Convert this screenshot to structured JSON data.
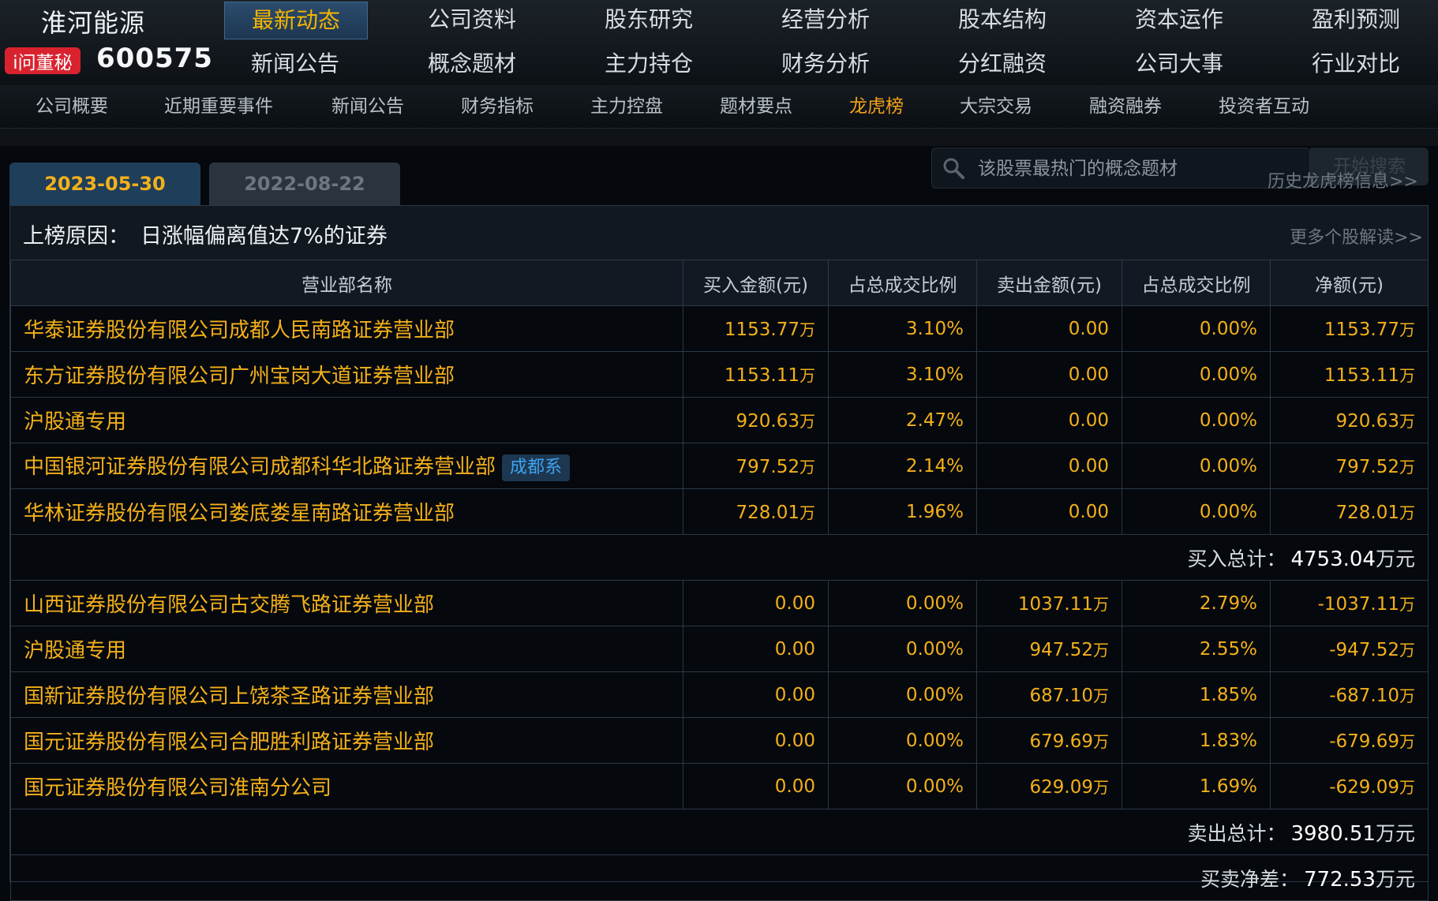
{
  "header": {
    "stock_name": "淮河能源",
    "badge": "i问董秘",
    "stock_code": "600575"
  },
  "top_nav": [
    [
      "最新动态",
      "新闻公告"
    ],
    [
      "公司资料",
      "概念题材"
    ],
    [
      "股东研究",
      "主力持仓"
    ],
    [
      "经营分析",
      "财务分析"
    ],
    [
      "股本结构",
      "分红融资"
    ],
    [
      "资本运作",
      "公司大事"
    ],
    [
      "盈利预测",
      "行业对比"
    ]
  ],
  "top_nav_active": "最新动态",
  "sub_nav": [
    "公司概要",
    "近期重要事件",
    "新闻公告",
    "财务指标",
    "主力控盘",
    "题材要点",
    "龙虎榜",
    "大宗交易",
    "融资融券",
    "投资者互动"
  ],
  "sub_nav_active": "龙虎榜",
  "tabs": [
    "2023-05-30",
    "2022-08-22"
  ],
  "search": {
    "placeholder": "该股票最热门的概念题材",
    "button": "开始搜索"
  },
  "history_link": "历史龙虎榜信息>>",
  "reason": {
    "label": "上榜原因：",
    "text": "日涨幅偏离值达7%的证券"
  },
  "more_link": "更多个股解读>>",
  "table": {
    "headers": [
      "营业部名称",
      "买入金额(元)",
      "占总成交比例",
      "卖出金额(元)",
      "占总成交比例",
      "净额(元)"
    ],
    "buy_rows": [
      {
        "name": "华泰证券股份有限公司成都人民南路证券营业部",
        "buy": "1153.77",
        "buy_pct": "3.10%",
        "sell": "0.00",
        "sell_pct": "0.00%",
        "net": "1153.77",
        "tag": ""
      },
      {
        "name": "东方证券股份有限公司广州宝岗大道证券营业部",
        "buy": "1153.11",
        "buy_pct": "3.10%",
        "sell": "0.00",
        "sell_pct": "0.00%",
        "net": "1153.11",
        "tag": ""
      },
      {
        "name": "沪股通专用",
        "buy": "920.63",
        "buy_pct": "2.47%",
        "sell": "0.00",
        "sell_pct": "0.00%",
        "net": "920.63",
        "tag": ""
      },
      {
        "name": "中国银河证券股份有限公司成都科华北路证券营业部",
        "buy": "797.52",
        "buy_pct": "2.14%",
        "sell": "0.00",
        "sell_pct": "0.00%",
        "net": "797.52",
        "tag": "成都系"
      },
      {
        "name": "华林证券股份有限公司娄底娄星南路证券营业部",
        "buy": "728.01",
        "buy_pct": "1.96%",
        "sell": "0.00",
        "sell_pct": "0.00%",
        "net": "728.01",
        "tag": ""
      }
    ],
    "buy_total_label": "买入总计：",
    "buy_total_value": "4753.04",
    "sell_rows": [
      {
        "name": "山西证券股份有限公司古交腾飞路证券营业部",
        "buy": "0.00",
        "buy_pct": "0.00%",
        "sell": "1037.11",
        "sell_pct": "2.79%",
        "net": "-1037.11"
      },
      {
        "name": "沪股通专用",
        "buy": "0.00",
        "buy_pct": "0.00%",
        "sell": "947.52",
        "sell_pct": "2.55%",
        "net": "-947.52"
      },
      {
        "name": "国新证券股份有限公司上饶茶圣路证券营业部",
        "buy": "0.00",
        "buy_pct": "0.00%",
        "sell": "687.10",
        "sell_pct": "1.85%",
        "net": "-687.10"
      },
      {
        "name": "国元证券股份有限公司合肥胜利路证券营业部",
        "buy": "0.00",
        "buy_pct": "0.00%",
        "sell": "679.69",
        "sell_pct": "1.83%",
        "net": "-679.69"
      },
      {
        "name": "国元证券股份有限公司淮南分公司",
        "buy": "0.00",
        "buy_pct": "0.00%",
        "sell": "629.09",
        "sell_pct": "1.69%",
        "net": "-629.09"
      }
    ],
    "sell_total_label": "卖出总计：",
    "sell_total_value": "3980.51",
    "net_diff_label": "买卖净差：",
    "net_diff_value": "772.53",
    "unit_wan": "万",
    "unit_wan_yuan": "万元"
  }
}
